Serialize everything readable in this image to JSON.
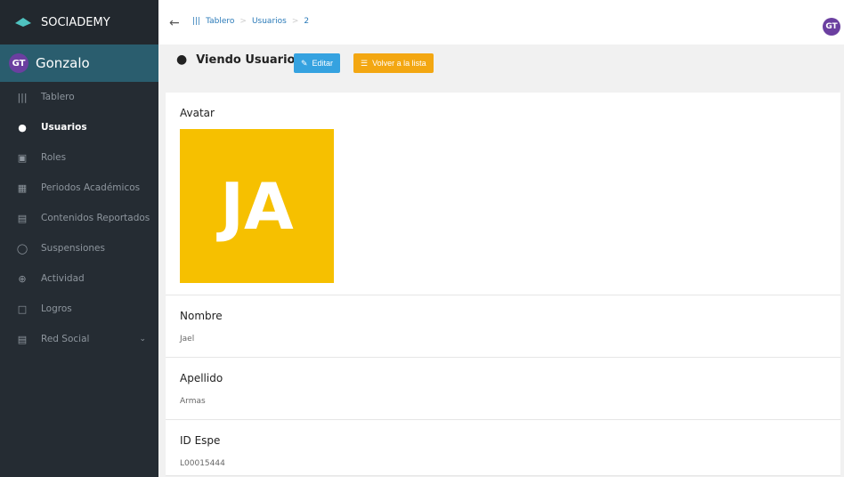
{
  "app": {
    "name": "SOCIADEMY"
  },
  "user": {
    "initials": "GT",
    "name": "Gonzalo"
  },
  "sidebar": {
    "items": [
      {
        "label": "Tablero",
        "icon": "dashboard-icon",
        "active": false
      },
      {
        "label": "Usuarios",
        "icon": "user-icon",
        "active": true
      },
      {
        "label": "Roles",
        "icon": "lock-icon",
        "active": false
      },
      {
        "label": "Periodos Académicos",
        "icon": "calendar-icon",
        "active": false
      },
      {
        "label": "Contenidos Reportados",
        "icon": "report-icon",
        "active": false
      },
      {
        "label": "Suspensiones",
        "icon": "suspension-icon",
        "active": false
      },
      {
        "label": "Actividad",
        "icon": "activity-icon",
        "active": false
      },
      {
        "label": "Logros",
        "icon": "achievement-icon",
        "active": false
      },
      {
        "label": "Red Social",
        "icon": "social-icon",
        "active": false
      }
    ]
  },
  "breadcrumb": {
    "items": [
      "Tablero",
      "Usuarios",
      "2"
    ],
    "separator": ">"
  },
  "header": {
    "title": "Viendo Usuario",
    "edit_label": "Editar",
    "list_label": "Volver a la lista"
  },
  "fields": {
    "avatar_label": "Avatar",
    "avatar_initials": "JA",
    "nombre_label": "Nombre",
    "nombre_value": "Jael",
    "apellido_label": "Apellido",
    "apellido_value": "Armas",
    "id_label": "ID Espe",
    "id_value": "L00015444"
  },
  "colors": {
    "sidebar_bg": "#252c33",
    "profile_bg": "#2a5d6e",
    "edit_button": "#35a2e0",
    "list_button": "#f3a712",
    "avatar_bg": "#f6c000",
    "user_avatar": "#6b3fa0"
  }
}
